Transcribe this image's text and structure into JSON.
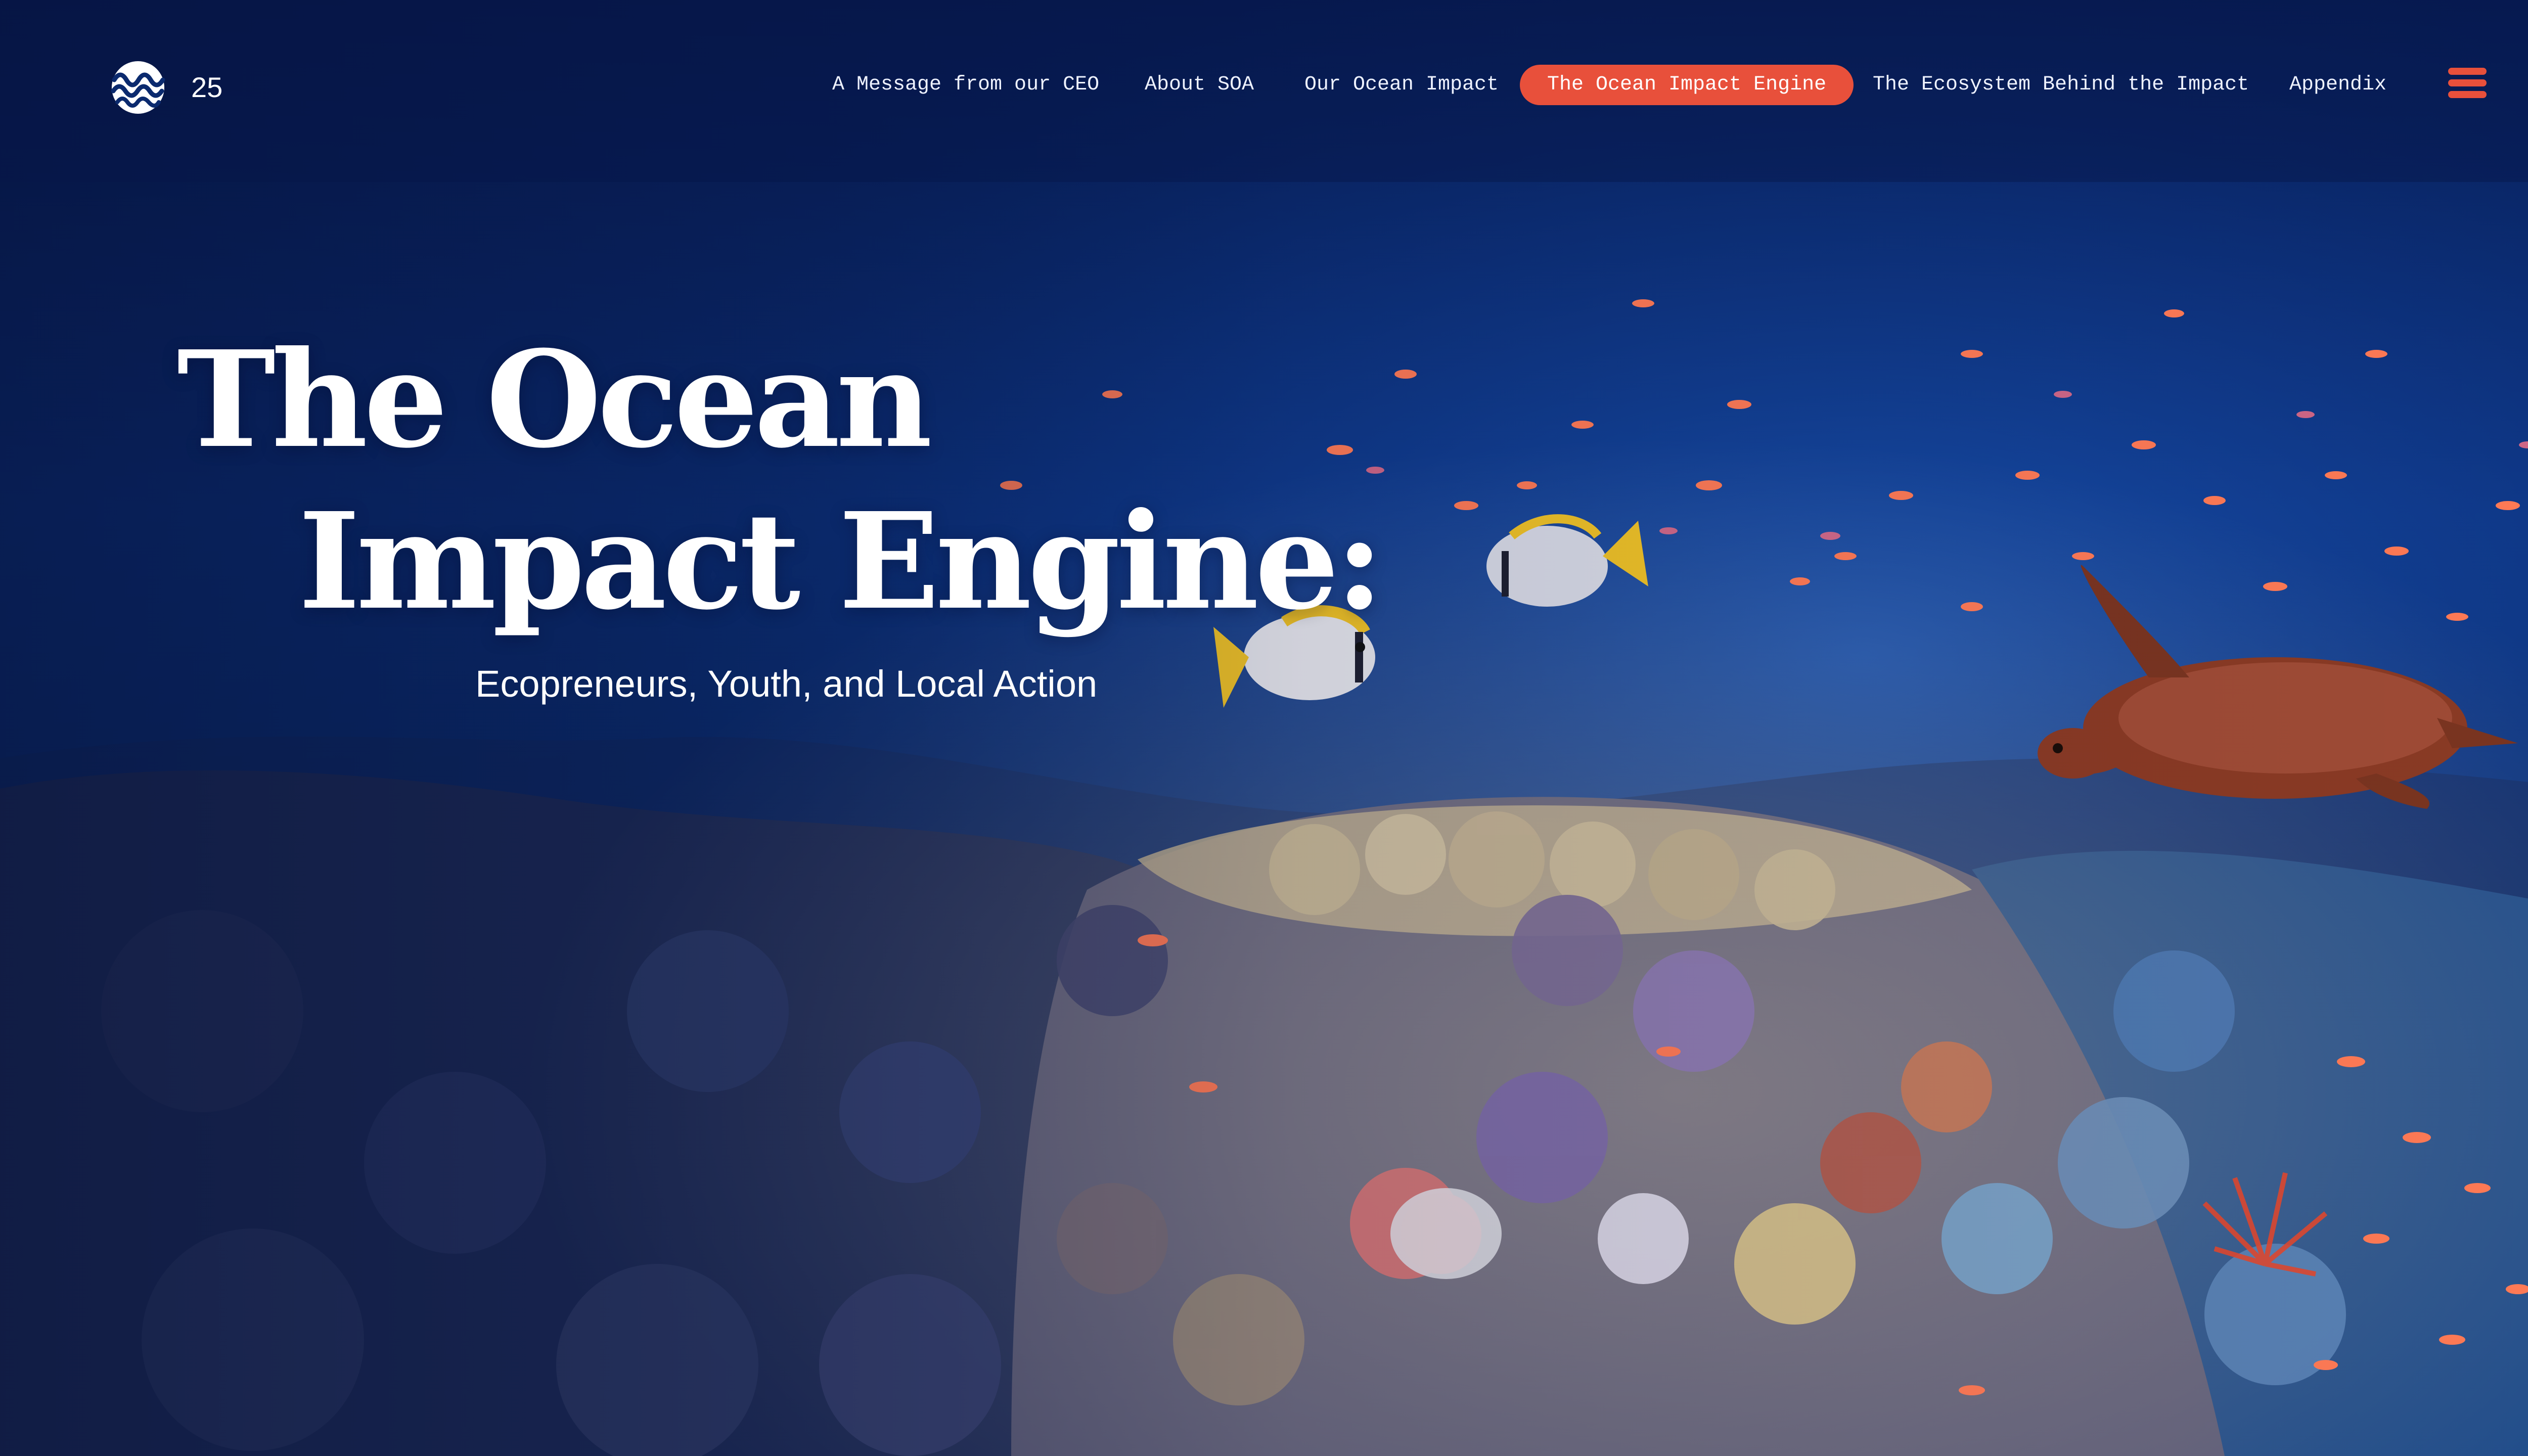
{
  "header": {
    "logo_icon": "wave-logo-icon",
    "edition": "25",
    "nav": [
      {
        "label": "A Message from our CEO",
        "active": false
      },
      {
        "label": "About SOA",
        "active": false
      },
      {
        "label": "Our Ocean Impact",
        "active": false
      },
      {
        "label": "The Ocean Impact Engine",
        "active": true
      },
      {
        "label": "The Ecosystem Behind the Impact",
        "active": false
      },
      {
        "label": "Appendix",
        "active": false
      }
    ],
    "menu_icon": "hamburger-menu-icon"
  },
  "hero": {
    "title_line1": "The Ocean",
    "title_line2": "Impact Engine:",
    "subtitle": "Ecopreneurs, Youth, and Local Action",
    "background": "coral-reef-photo"
  },
  "colors": {
    "accent": "#e8503b",
    "ocean_deep": "#061a4d",
    "ocean_mid": "#0e3a8c",
    "text": "#ffffff"
  }
}
